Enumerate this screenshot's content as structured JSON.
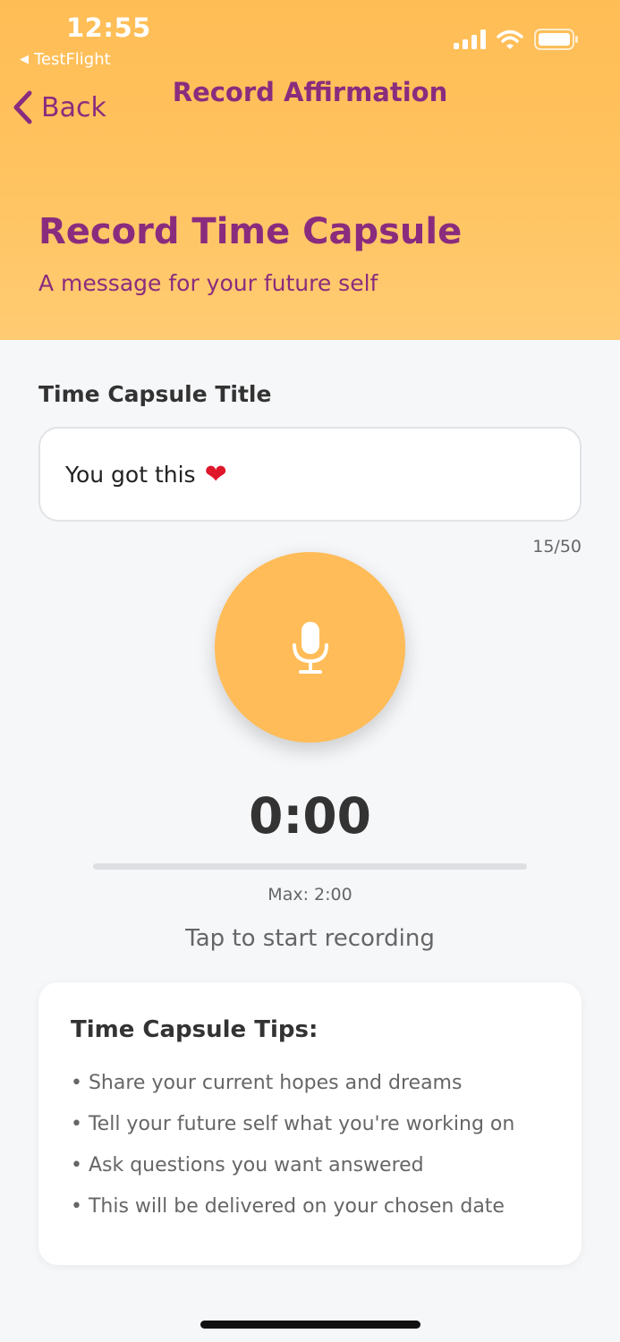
{
  "status_bar": {
    "time": "12:55",
    "back_app": "TestFlight"
  },
  "nav": {
    "back_label": "Back",
    "title": "Record Affirmation"
  },
  "hero": {
    "title": "Record Time Capsule",
    "subtitle": "A message for your future self"
  },
  "form": {
    "title_label": "Time Capsule Title",
    "title_value": "You got this",
    "title_emoji": "❤",
    "char_count": "15/50"
  },
  "recorder": {
    "mic_icon": "microphone-icon",
    "timer": "0:00",
    "progress_fraction": 0,
    "max_label": "Max: 2:00",
    "hint": "Tap to start recording"
  },
  "tips": {
    "title": "Time Capsule Tips:",
    "items": [
      "• Share your current hopes and dreams",
      "• Tell your future self what you're working on",
      "• Ask questions you want answered",
      "• This will be delivered on your chosen date"
    ]
  },
  "colors": {
    "accent": "#FFBC58",
    "brand_purple": "#8A2C7E",
    "background": "#F6F7F9"
  }
}
